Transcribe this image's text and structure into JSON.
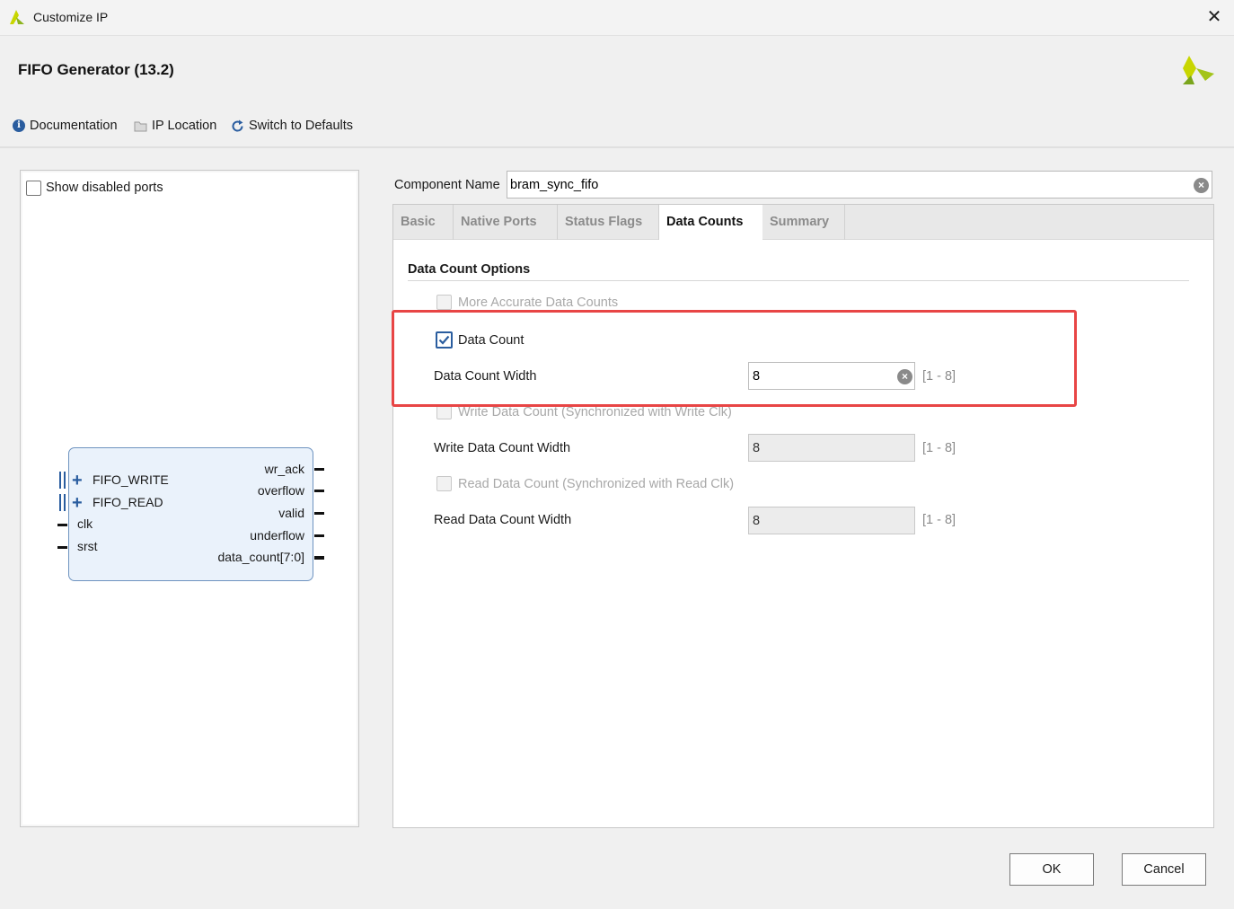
{
  "window": {
    "title": "Customize IP",
    "close_glyph": "✕"
  },
  "header": {
    "ip_title": "FIFO Generator (13.2)",
    "toolbar": {
      "documentation": "Documentation",
      "ip_location": "IP Location",
      "switch_defaults": "Switch to Defaults"
    }
  },
  "left_panel": {
    "show_disabled_ports": {
      "label": "Show disabled ports",
      "checked": false
    },
    "symbol": {
      "left_bus_ports": [
        "FIFO_WRITE",
        "FIFO_READ"
      ],
      "left_ports": [
        "clk",
        "srst"
      ],
      "right_ports": [
        "wr_ack",
        "overflow",
        "valid",
        "underflow",
        "data_count[7:0]"
      ]
    }
  },
  "component": {
    "label": "Component Name",
    "value": "bram_sync_fifo"
  },
  "tabs": [
    {
      "label": "Basic",
      "active": false
    },
    {
      "label": "Native Ports",
      "active": false
    },
    {
      "label": "Status Flags",
      "active": false
    },
    {
      "label": "Data Counts",
      "active": true
    },
    {
      "label": "Summary",
      "active": false
    }
  ],
  "data_counts": {
    "section_title": "Data Count Options",
    "more_accurate": {
      "label": "More Accurate Data Counts",
      "checked": false,
      "enabled": false
    },
    "data_count": {
      "label": "Data Count",
      "checked": true,
      "enabled": true
    },
    "data_count_width": {
      "label": "Data Count Width",
      "value": "8",
      "range": "[1 - 8]"
    },
    "write_data_count": {
      "label": "Write Data Count (Synchronized with Write Clk)",
      "checked": false,
      "enabled": false
    },
    "write_data_count_width": {
      "label": "Write Data Count Width",
      "value": "8",
      "range": "[1 - 8]"
    },
    "read_data_count": {
      "label": "Read Data Count (Synchronized with Read Clk)",
      "checked": false,
      "enabled": false
    },
    "read_data_count_width": {
      "label": "Read Data Count Width",
      "value": "8",
      "range": "[1 - 8]"
    }
  },
  "footer": {
    "ok": "OK",
    "cancel": "Cancel"
  },
  "colors": {
    "accent": "#2a5d9f",
    "highlight": "#e84545",
    "brand": "#8db41e"
  }
}
